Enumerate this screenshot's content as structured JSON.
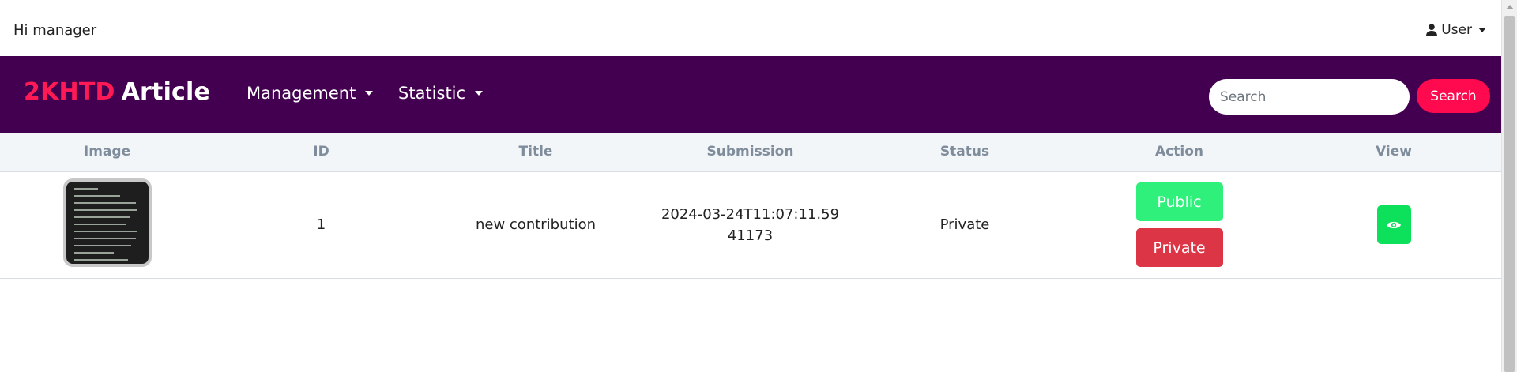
{
  "topbar": {
    "greeting": "Hi manager",
    "user_label": "User"
  },
  "navbar": {
    "brand_accent": "2KHTD",
    "brand_rest": "Article",
    "menus": [
      {
        "label": "Management"
      },
      {
        "label": "Statistic"
      }
    ],
    "search_placeholder": "Search",
    "search_button": "Search"
  },
  "table": {
    "columns": [
      "Image",
      "ID",
      "Title",
      "Submission",
      "Status",
      "Action",
      "View"
    ],
    "rows": [
      {
        "id": "1",
        "title": "new contribution",
        "submission": "2024-03-24T11:07:11.5941173",
        "status": "Private",
        "action_public": "Public",
        "action_private": "Private",
        "view_icon": "eye-icon"
      }
    ]
  },
  "colors": {
    "navbar_bg": "#440050",
    "brand_accent": "#ff1a55",
    "search_button": "#ff0a4f",
    "public_button": "#2ef07b",
    "private_button": "#dc3545",
    "view_button": "#0de05a"
  }
}
